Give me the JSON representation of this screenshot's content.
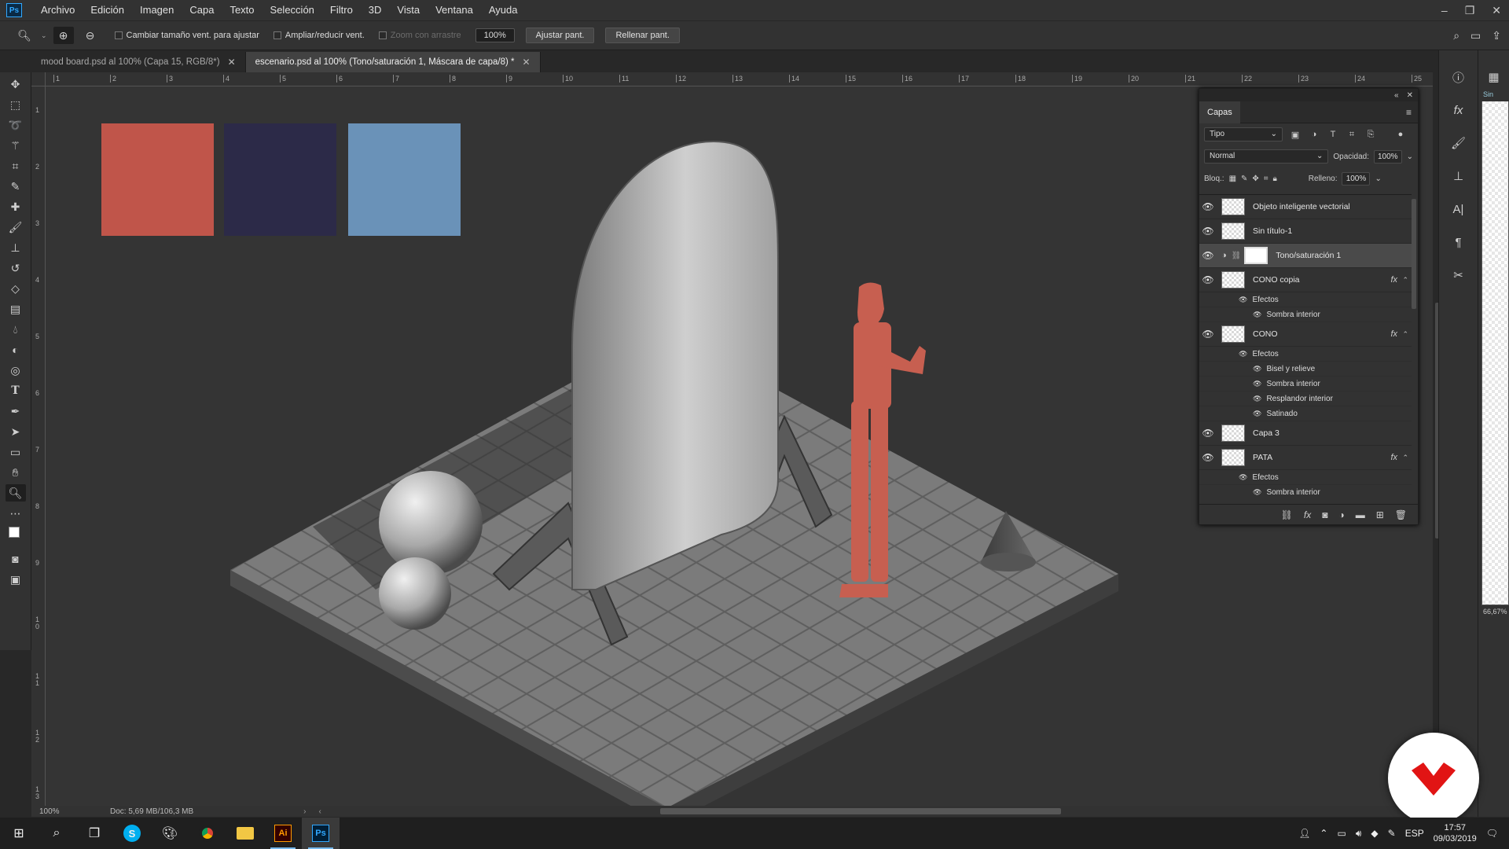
{
  "menubar": {
    "app_logo": "Ps",
    "items": [
      "Archivo",
      "Edición",
      "Imagen",
      "Capa",
      "Texto",
      "Selección",
      "Filtro",
      "3D",
      "Vista",
      "Ventana",
      "Ayuda"
    ]
  },
  "options": {
    "check1": "Cambiar tamaño vent. para ajustar",
    "check2": "Ampliar/reducir vent.",
    "check3": "Zoom con arrastre",
    "zoom_value": "100%",
    "btn_fit": "Ajustar pant.",
    "btn_fill": "Rellenar pant."
  },
  "tabs": [
    {
      "label": "mood board.psd al 100% (Capa 15, RGB/8*)"
    },
    {
      "label": "escenario.psd al 100% (Tono/saturación 1, Máscara de capa/8) *"
    }
  ],
  "ruler_top": [
    "1",
    "2",
    "3",
    "4",
    "5",
    "6",
    "7",
    "8",
    "9",
    "10",
    "11",
    "12",
    "13",
    "14",
    "15",
    "16",
    "17",
    "18",
    "19",
    "20",
    "21",
    "22",
    "23",
    "24",
    "25"
  ],
  "ruler_left": [
    "1",
    "2",
    "3",
    "4",
    "5",
    "6",
    "7",
    "8",
    "9",
    "1\n0",
    "1\n1",
    "1\n2",
    "1\n3"
  ],
  "palette_colors": [
    "#c0554a",
    "#2c2a48",
    "#6a92b8"
  ],
  "figure_color": "#c75f50",
  "status": {
    "zoom": "100%",
    "doc": "Doc: 5,69 MB/106,3 MB"
  },
  "layers_panel": {
    "tab": "Capas",
    "filter": "Tipo",
    "blend_mode": "Normal",
    "opacity_label": "Opacidad:",
    "opacity_value": "100%",
    "lock_label": "Bloq.:",
    "fill_label": "Relleno:",
    "fill_value": "100%",
    "layers": [
      {
        "name": "Objeto inteligente vectorial",
        "fx": false
      },
      {
        "name": "Sin título-1",
        "fx": false
      },
      {
        "name": "Tono/saturación 1",
        "fx": false,
        "adjustment": true
      },
      {
        "name": "CONO copia",
        "fx": true,
        "effects_label": "Efectos",
        "effects": [
          "Sombra interior"
        ]
      },
      {
        "name": "CONO",
        "fx": true,
        "effects_label": "Efectos",
        "effects": [
          "Bisel y relieve",
          "Sombra interior",
          "Resplandor interior",
          "Satinado"
        ]
      },
      {
        "name": "Capa 3",
        "fx": false
      },
      {
        "name": "PATA",
        "fx": true,
        "effects_label": "Efectos",
        "effects": [
          "Sombra interior"
        ]
      }
    ]
  },
  "right_dock": {
    "ps_tag": "Sin",
    "zoom": "66,67%"
  },
  "taskbar": {
    "lang": "ESP",
    "time": "17:57",
    "date": "09/03/2019"
  }
}
